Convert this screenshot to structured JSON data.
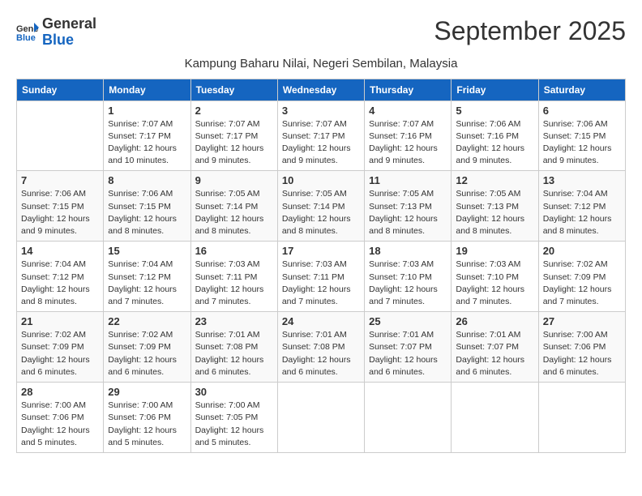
{
  "header": {
    "logo_general": "General",
    "logo_blue": "Blue",
    "month_title": "September 2025",
    "subtitle": "Kampung Baharu Nilai, Negeri Sembilan, Malaysia"
  },
  "calendar": {
    "days_of_week": [
      "Sunday",
      "Monday",
      "Tuesday",
      "Wednesday",
      "Thursday",
      "Friday",
      "Saturday"
    ],
    "weeks": [
      [
        {
          "day": "",
          "info": ""
        },
        {
          "day": "1",
          "info": "Sunrise: 7:07 AM\nSunset: 7:17 PM\nDaylight: 12 hours\nand 10 minutes."
        },
        {
          "day": "2",
          "info": "Sunrise: 7:07 AM\nSunset: 7:17 PM\nDaylight: 12 hours\nand 9 minutes."
        },
        {
          "day": "3",
          "info": "Sunrise: 7:07 AM\nSunset: 7:17 PM\nDaylight: 12 hours\nand 9 minutes."
        },
        {
          "day": "4",
          "info": "Sunrise: 7:07 AM\nSunset: 7:16 PM\nDaylight: 12 hours\nand 9 minutes."
        },
        {
          "day": "5",
          "info": "Sunrise: 7:06 AM\nSunset: 7:16 PM\nDaylight: 12 hours\nand 9 minutes."
        },
        {
          "day": "6",
          "info": "Sunrise: 7:06 AM\nSunset: 7:15 PM\nDaylight: 12 hours\nand 9 minutes."
        }
      ],
      [
        {
          "day": "7",
          "info": "Sunrise: 7:06 AM\nSunset: 7:15 PM\nDaylight: 12 hours\nand 9 minutes."
        },
        {
          "day": "8",
          "info": "Sunrise: 7:06 AM\nSunset: 7:15 PM\nDaylight: 12 hours\nand 8 minutes."
        },
        {
          "day": "9",
          "info": "Sunrise: 7:05 AM\nSunset: 7:14 PM\nDaylight: 12 hours\nand 8 minutes."
        },
        {
          "day": "10",
          "info": "Sunrise: 7:05 AM\nSunset: 7:14 PM\nDaylight: 12 hours\nand 8 minutes."
        },
        {
          "day": "11",
          "info": "Sunrise: 7:05 AM\nSunset: 7:13 PM\nDaylight: 12 hours\nand 8 minutes."
        },
        {
          "day": "12",
          "info": "Sunrise: 7:05 AM\nSunset: 7:13 PM\nDaylight: 12 hours\nand 8 minutes."
        },
        {
          "day": "13",
          "info": "Sunrise: 7:04 AM\nSunset: 7:12 PM\nDaylight: 12 hours\nand 8 minutes."
        }
      ],
      [
        {
          "day": "14",
          "info": "Sunrise: 7:04 AM\nSunset: 7:12 PM\nDaylight: 12 hours\nand 8 minutes."
        },
        {
          "day": "15",
          "info": "Sunrise: 7:04 AM\nSunset: 7:12 PM\nDaylight: 12 hours\nand 7 minutes."
        },
        {
          "day": "16",
          "info": "Sunrise: 7:03 AM\nSunset: 7:11 PM\nDaylight: 12 hours\nand 7 minutes."
        },
        {
          "day": "17",
          "info": "Sunrise: 7:03 AM\nSunset: 7:11 PM\nDaylight: 12 hours\nand 7 minutes."
        },
        {
          "day": "18",
          "info": "Sunrise: 7:03 AM\nSunset: 7:10 PM\nDaylight: 12 hours\nand 7 minutes."
        },
        {
          "day": "19",
          "info": "Sunrise: 7:03 AM\nSunset: 7:10 PM\nDaylight: 12 hours\nand 7 minutes."
        },
        {
          "day": "20",
          "info": "Sunrise: 7:02 AM\nSunset: 7:09 PM\nDaylight: 12 hours\nand 7 minutes."
        }
      ],
      [
        {
          "day": "21",
          "info": "Sunrise: 7:02 AM\nSunset: 7:09 PM\nDaylight: 12 hours\nand 6 minutes."
        },
        {
          "day": "22",
          "info": "Sunrise: 7:02 AM\nSunset: 7:09 PM\nDaylight: 12 hours\nand 6 minutes."
        },
        {
          "day": "23",
          "info": "Sunrise: 7:01 AM\nSunset: 7:08 PM\nDaylight: 12 hours\nand 6 minutes."
        },
        {
          "day": "24",
          "info": "Sunrise: 7:01 AM\nSunset: 7:08 PM\nDaylight: 12 hours\nand 6 minutes."
        },
        {
          "day": "25",
          "info": "Sunrise: 7:01 AM\nSunset: 7:07 PM\nDaylight: 12 hours\nand 6 minutes."
        },
        {
          "day": "26",
          "info": "Sunrise: 7:01 AM\nSunset: 7:07 PM\nDaylight: 12 hours\nand 6 minutes."
        },
        {
          "day": "27",
          "info": "Sunrise: 7:00 AM\nSunset: 7:06 PM\nDaylight: 12 hours\nand 6 minutes."
        }
      ],
      [
        {
          "day": "28",
          "info": "Sunrise: 7:00 AM\nSunset: 7:06 PM\nDaylight: 12 hours\nand 5 minutes."
        },
        {
          "day": "29",
          "info": "Sunrise: 7:00 AM\nSunset: 7:06 PM\nDaylight: 12 hours\nand 5 minutes."
        },
        {
          "day": "30",
          "info": "Sunrise: 7:00 AM\nSunset: 7:05 PM\nDaylight: 12 hours\nand 5 minutes."
        },
        {
          "day": "",
          "info": ""
        },
        {
          "day": "",
          "info": ""
        },
        {
          "day": "",
          "info": ""
        },
        {
          "day": "",
          "info": ""
        }
      ]
    ]
  }
}
